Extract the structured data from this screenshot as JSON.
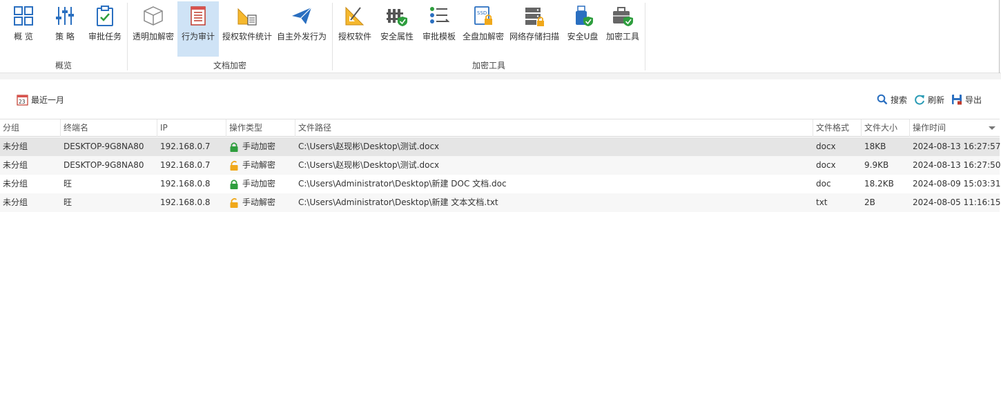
{
  "ribbon": {
    "groups": [
      {
        "label": "概览",
        "buttons": [
          {
            "label": "概 览",
            "icon": "grid-icon"
          },
          {
            "label": "策 略",
            "icon": "sliders-icon"
          },
          {
            "label": "审批任务",
            "icon": "clipboard-check-icon"
          }
        ]
      },
      {
        "label": "文档加密",
        "buttons": [
          {
            "label": "透明加解密",
            "icon": "cube-icon"
          },
          {
            "label": "行为审计",
            "icon": "document-list-icon",
            "active": true
          },
          {
            "label": "授权软件统计",
            "icon": "ruler-report-icon"
          },
          {
            "label": "自主外发行为",
            "icon": "paper-plane-icon"
          }
        ]
      },
      {
        "label": "加密工具",
        "buttons": [
          {
            "label": "授权软件",
            "icon": "set-square-icon"
          },
          {
            "label": "安全属性",
            "icon": "fence-shield-icon"
          },
          {
            "label": "审批模板",
            "icon": "checklist-icon"
          },
          {
            "label": "全盘加解密",
            "icon": "ssd-lock-icon"
          },
          {
            "label": "网络存储扫描",
            "icon": "server-lock-icon"
          },
          {
            "label": "安全U盘",
            "icon": "usb-shield-icon"
          },
          {
            "label": "加密工具",
            "icon": "toolbox-shield-icon"
          }
        ]
      }
    ]
  },
  "toolbar": {
    "date_filter": "最近一月",
    "search": "搜索",
    "refresh": "刷新",
    "export": "导出"
  },
  "table": {
    "columns": [
      "分组",
      "终端名",
      "IP",
      "操作类型",
      "文件路径",
      "文件格式",
      "文件大小",
      "操作时间"
    ],
    "rows": [
      {
        "group": "未分组",
        "terminal": "DESKTOP-9G8NA80",
        "ip": "192.168.0.7",
        "op": "手动加密",
        "op_icon": "lock-closed-icon",
        "path": "C:\\Users\\赵现彬\\Desktop\\测试.docx",
        "format": "docx",
        "size": "18KB",
        "time": "2024-08-13 16:27:57"
      },
      {
        "group": "未分组",
        "terminal": "DESKTOP-9G8NA80",
        "ip": "192.168.0.7",
        "op": "手动解密",
        "op_icon": "lock-open-icon",
        "path": "C:\\Users\\赵现彬\\Desktop\\测试.docx",
        "format": "docx",
        "size": "9.9KB",
        "time": "2024-08-13 16:27:50"
      },
      {
        "group": "未分组",
        "terminal": "旺",
        "ip": "192.168.0.8",
        "op": "手动加密",
        "op_icon": "lock-closed-icon",
        "path": "C:\\Users\\Administrator\\Desktop\\新建 DOC 文档.doc",
        "format": "doc",
        "size": "18.2KB",
        "time": "2024-08-09 15:03:31"
      },
      {
        "group": "未分组",
        "terminal": "旺",
        "ip": "192.168.0.8",
        "op": "手动解密",
        "op_icon": "lock-open-icon",
        "path": "C:\\Users\\Administrator\\Desktop\\新建 文本文档.txt",
        "format": "txt",
        "size": "2B",
        "time": "2024-08-05 11:16:15"
      }
    ]
  },
  "colors": {
    "accent_blue": "#2a6fc0",
    "active_button": "#cfe3f6",
    "lock_green": "#2e9e3e",
    "lock_orange": "#f0a81a"
  }
}
